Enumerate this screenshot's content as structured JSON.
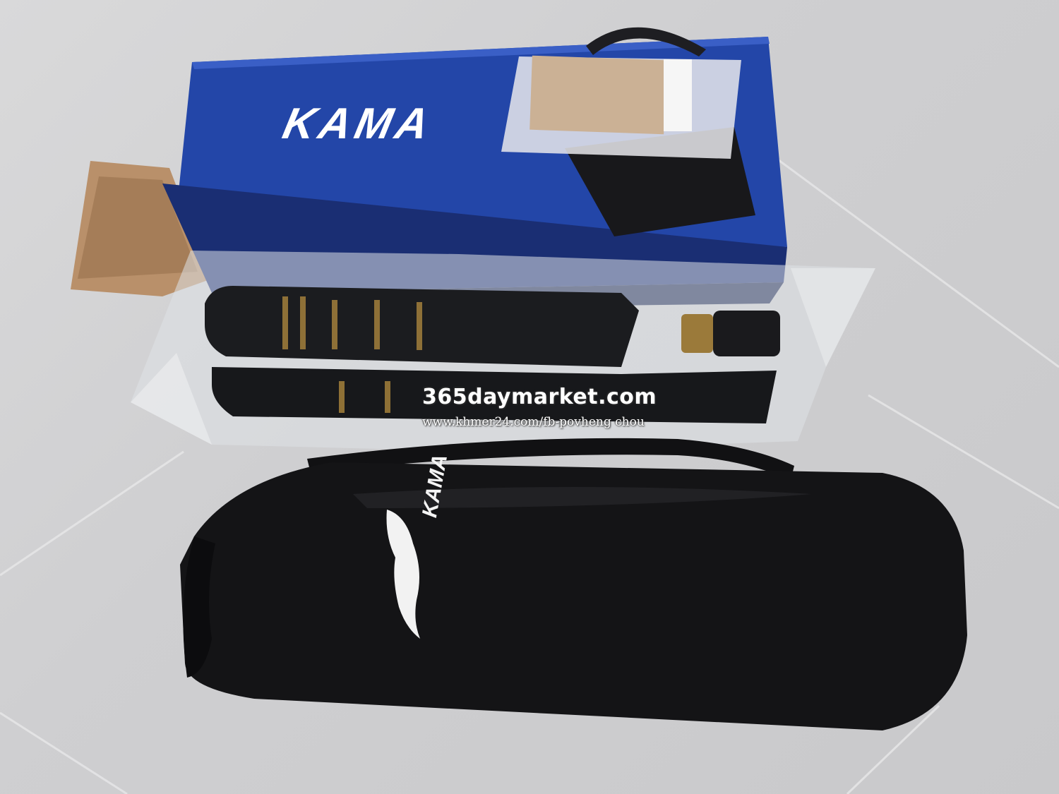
{
  "scene": {
    "description_items": [
      "blue-product-box",
      "certificate-bag",
      "tripod-in-plastic",
      "black-carry-bag",
      "floor-tiles"
    ],
    "colors": {
      "floor": "#d0d0d2",
      "box_blue": "#1f3f9c",
      "box_dark": "#162a6b",
      "cardboard": "#b98f67",
      "bag_black": "#141416",
      "brass": "#9b7a3a"
    }
  },
  "box": {
    "brand_text": "KAMA"
  },
  "bag": {
    "brand_text": "KAMA"
  },
  "watermark": {
    "main": "365daymarket.com",
    "sub": "www.khmer24.com/fb-povheng   chou"
  }
}
